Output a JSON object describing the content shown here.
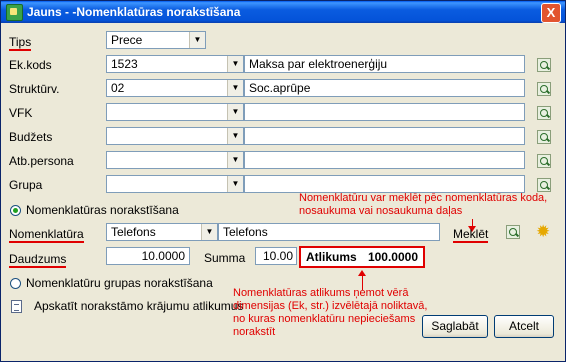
{
  "window": {
    "title": "Jauns - -Nomenklatūras norakstīšana",
    "close_glyph": "X"
  },
  "form": {
    "tips": {
      "label": "Tips",
      "value": "Prece"
    },
    "ekkods": {
      "label": "Ek.kods",
      "code": "1523",
      "name": "Maksa par elektroenerģiju"
    },
    "struktur": {
      "label": "Struktūrv.",
      "code": "02",
      "name": "Soc.aprūpe"
    },
    "vfk": {
      "label": "VFK",
      "code": "",
      "name": ""
    },
    "budzets": {
      "label": "Budžets",
      "code": "",
      "name": ""
    },
    "atbpersona": {
      "label": "Atb.persona",
      "code": "",
      "name": ""
    },
    "grupa": {
      "label": "Grupa",
      "code": "",
      "name": ""
    },
    "radio_nomenklaturas": {
      "label": "Nomenklatūras norakstīšana",
      "checked": true
    },
    "nomenklatura": {
      "label": "Nomenklatūra",
      "code": "Telefons",
      "name": "Telefons"
    },
    "meklet_label": "Meklēt",
    "daudzums": {
      "label": "Daudzums",
      "value": "10.0000"
    },
    "summa": {
      "label": "Summa",
      "value": "10.00"
    },
    "atlikums": {
      "label": "Atlikums",
      "value": "100.0000"
    },
    "radio_grupas": {
      "label": "Nomenklatūru grupas norakstīšana",
      "checked": false
    },
    "apskatit_label": "Apskatīt norakstāmo krājumu atlikumus"
  },
  "notes": {
    "search_note": [
      "Nomenklatūru var meklēt pēc nomenklatūras koda,",
      "nosaukuma vai nosaukuma daļas"
    ],
    "atlikums_note": [
      "Nomenklatūras atlikums ņemot vērā",
      "dimensijas (Ek, str.) izvēlētajā noliktavā,",
      "no kuras nomenklatūru nepieciešams",
      "norakstīt"
    ]
  },
  "buttons": {
    "save": "Saglabāt",
    "cancel": "Atcelt"
  },
  "colors": {
    "titlebar": "#0a5ce0",
    "annotation": "#e00000",
    "dialog_bg": "#ece9d8"
  }
}
